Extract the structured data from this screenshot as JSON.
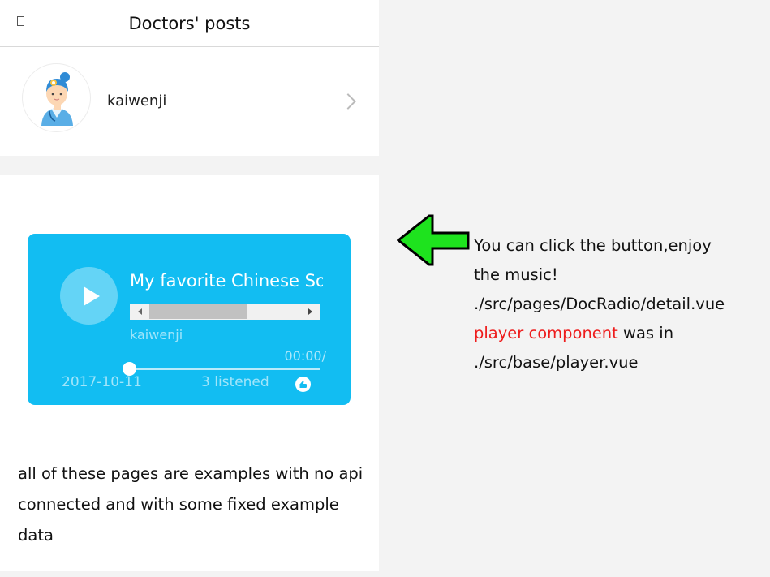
{
  "header": {
    "title": "Doctors' posts",
    "back_icon": "back-icon"
  },
  "doctor": {
    "name": "kaiwenji",
    "avatar_icon": "doctor-avatar-icon",
    "chevron_icon": "chevron-right-icon"
  },
  "player": {
    "title": "My favorite Chinese Sor",
    "artist": "kaiwenji",
    "time": "00:00/",
    "date": "2017-10-11",
    "listened": "3 listened",
    "progress": 0,
    "colors": {
      "card": "#12bdf2"
    }
  },
  "note": "all of these pages are examples with no api connected and with some fixed example data",
  "annotation": {
    "line1": "You can click the button,enjoy",
    "line2": "the music!",
    "line3": "./src/pages/DocRadio/detail.vue",
    "red": "player component",
    "after_red": " was in",
    "line5": "./src/base/player.vue",
    "arrow_color": "#1ee31e"
  }
}
